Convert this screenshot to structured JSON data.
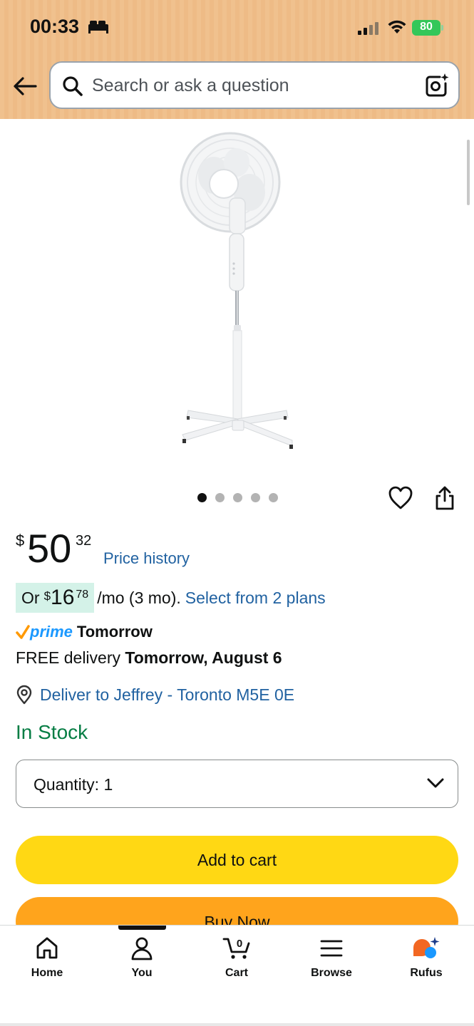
{
  "status_bar": {
    "time": "00:33",
    "battery": "80"
  },
  "search": {
    "placeholder": "Search or ask a question"
  },
  "gallery": {
    "image_count": 5,
    "active_index": 0
  },
  "price": {
    "symbol": "$",
    "whole": "50",
    "fraction": "32",
    "history_link": "Price history"
  },
  "installment": {
    "or": "Or",
    "symbol": "$",
    "whole": "16",
    "fraction": "78",
    "rest": "/mo (3 mo).",
    "link": "Select from 2 plans"
  },
  "prime": {
    "word": "prime",
    "day": "Tomorrow"
  },
  "delivery": {
    "prefix": "FREE delivery",
    "date": "Tomorrow, August 6"
  },
  "deliver_to": "Deliver to Jeffrey - Toronto M5E 0E",
  "stock": "In Stock",
  "quantity": {
    "label": "Quantity:",
    "value": "1"
  },
  "actions": {
    "add_to_cart": "Add to cart",
    "buy_now": "Buy Now"
  },
  "nav": {
    "items": [
      {
        "label": "Home",
        "icon": "home-icon"
      },
      {
        "label": "You",
        "icon": "person-icon"
      },
      {
        "label": "Cart",
        "icon": "cart-icon",
        "count": "0"
      },
      {
        "label": "Browse",
        "icon": "menu-icon"
      },
      {
        "label": "Rufus",
        "icon": "rufus-icon"
      }
    ],
    "active": "You"
  },
  "colors": {
    "header": "#f0c18e",
    "link": "#2162a1",
    "stock": "#067d44",
    "add_to_cart": "#ffd814",
    "buy_now": "#ffa41c",
    "prime": "#1a98ff"
  }
}
